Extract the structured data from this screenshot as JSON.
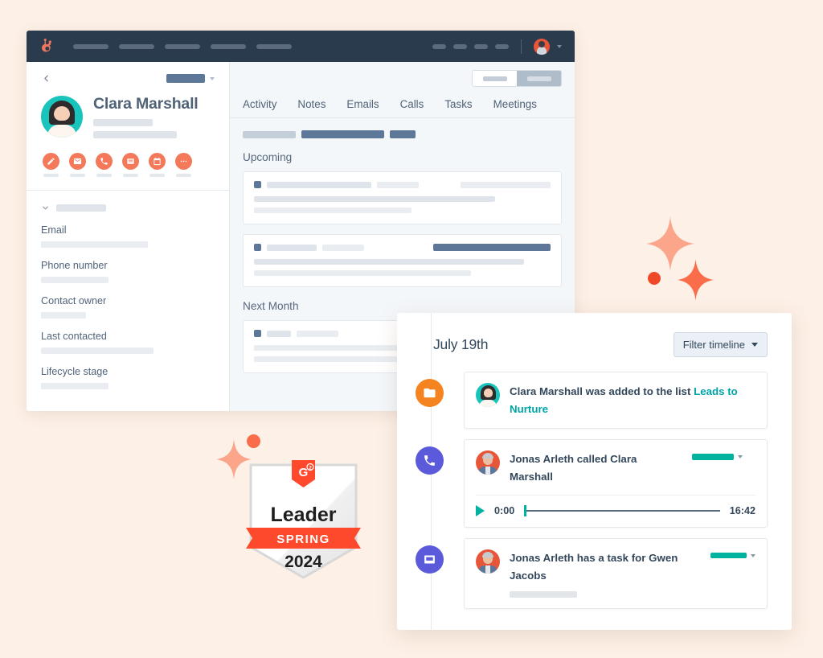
{
  "crm": {
    "topbar": {
      "logo_icon": "hubspot-sprocket-icon",
      "nav_item_count": 5,
      "avatar_icon": "user-avatar"
    },
    "contact": {
      "back_icon": "chevron-left-icon",
      "name": "Clara Marshall",
      "avatar_icon": "contact-avatar-clara",
      "actions": [
        {
          "icon": "pencil-icon",
          "name": "edit"
        },
        {
          "icon": "envelope-icon",
          "name": "email"
        },
        {
          "icon": "phone-icon",
          "name": "call"
        },
        {
          "icon": "note-icon",
          "name": "note"
        },
        {
          "icon": "calendar-icon",
          "name": "meeting"
        },
        {
          "icon": "ellipsis-icon",
          "name": "more"
        }
      ],
      "fields": [
        {
          "label": "Email"
        },
        {
          "label": "Phone number"
        },
        {
          "label": "Contact owner"
        },
        {
          "label": "Last contacted"
        },
        {
          "label": "Lifecycle stage"
        }
      ]
    },
    "activity": {
      "tabs": [
        {
          "label": "Activity"
        },
        {
          "label": "Notes"
        },
        {
          "label": "Emails"
        },
        {
          "label": "Calls"
        },
        {
          "label": "Tasks"
        },
        {
          "label": "Meetings"
        }
      ],
      "sections": [
        {
          "title": "Upcoming",
          "cards": 2
        },
        {
          "title": "Next Month",
          "cards": 1
        }
      ]
    }
  },
  "timeline": {
    "date_heading": "July 19th",
    "filter_button": {
      "label": "Filter timeline",
      "caret_icon": "chevron-down-icon"
    },
    "items": [
      {
        "icon": "folder-list-icon",
        "icon_color": "#f5831f",
        "avatar": "clara",
        "text_before": "Clara Marshall was added to the list ",
        "link_text": "Leads to Nurture",
        "badge": false
      },
      {
        "icon": "phone-icon",
        "icon_color": "#5a5adb",
        "avatar": "jonas",
        "text": "Jonas Arleth called Clara Marshall",
        "badge": true,
        "audio": {
          "play_icon": "play-icon",
          "current_time": "0:00",
          "duration": "16:42"
        }
      },
      {
        "icon": "task-tray-icon",
        "icon_color": "#5a5adb",
        "avatar": "jonas",
        "text": "Jonas Arleth has a task for Gwen Jacobs",
        "badge": true
      }
    ]
  },
  "g2_badge": {
    "logo_text": "G2",
    "title": "Leader",
    "season": "SPRING",
    "year": "2024"
  },
  "colors": {
    "page_background": "#fdf0e6",
    "nav_dark": "#2b3b4e",
    "hubspot_orange": "#f4785a",
    "teal_link": "#00a4a6",
    "purple": "#5a5adb",
    "g2_red": "#ff492c"
  }
}
